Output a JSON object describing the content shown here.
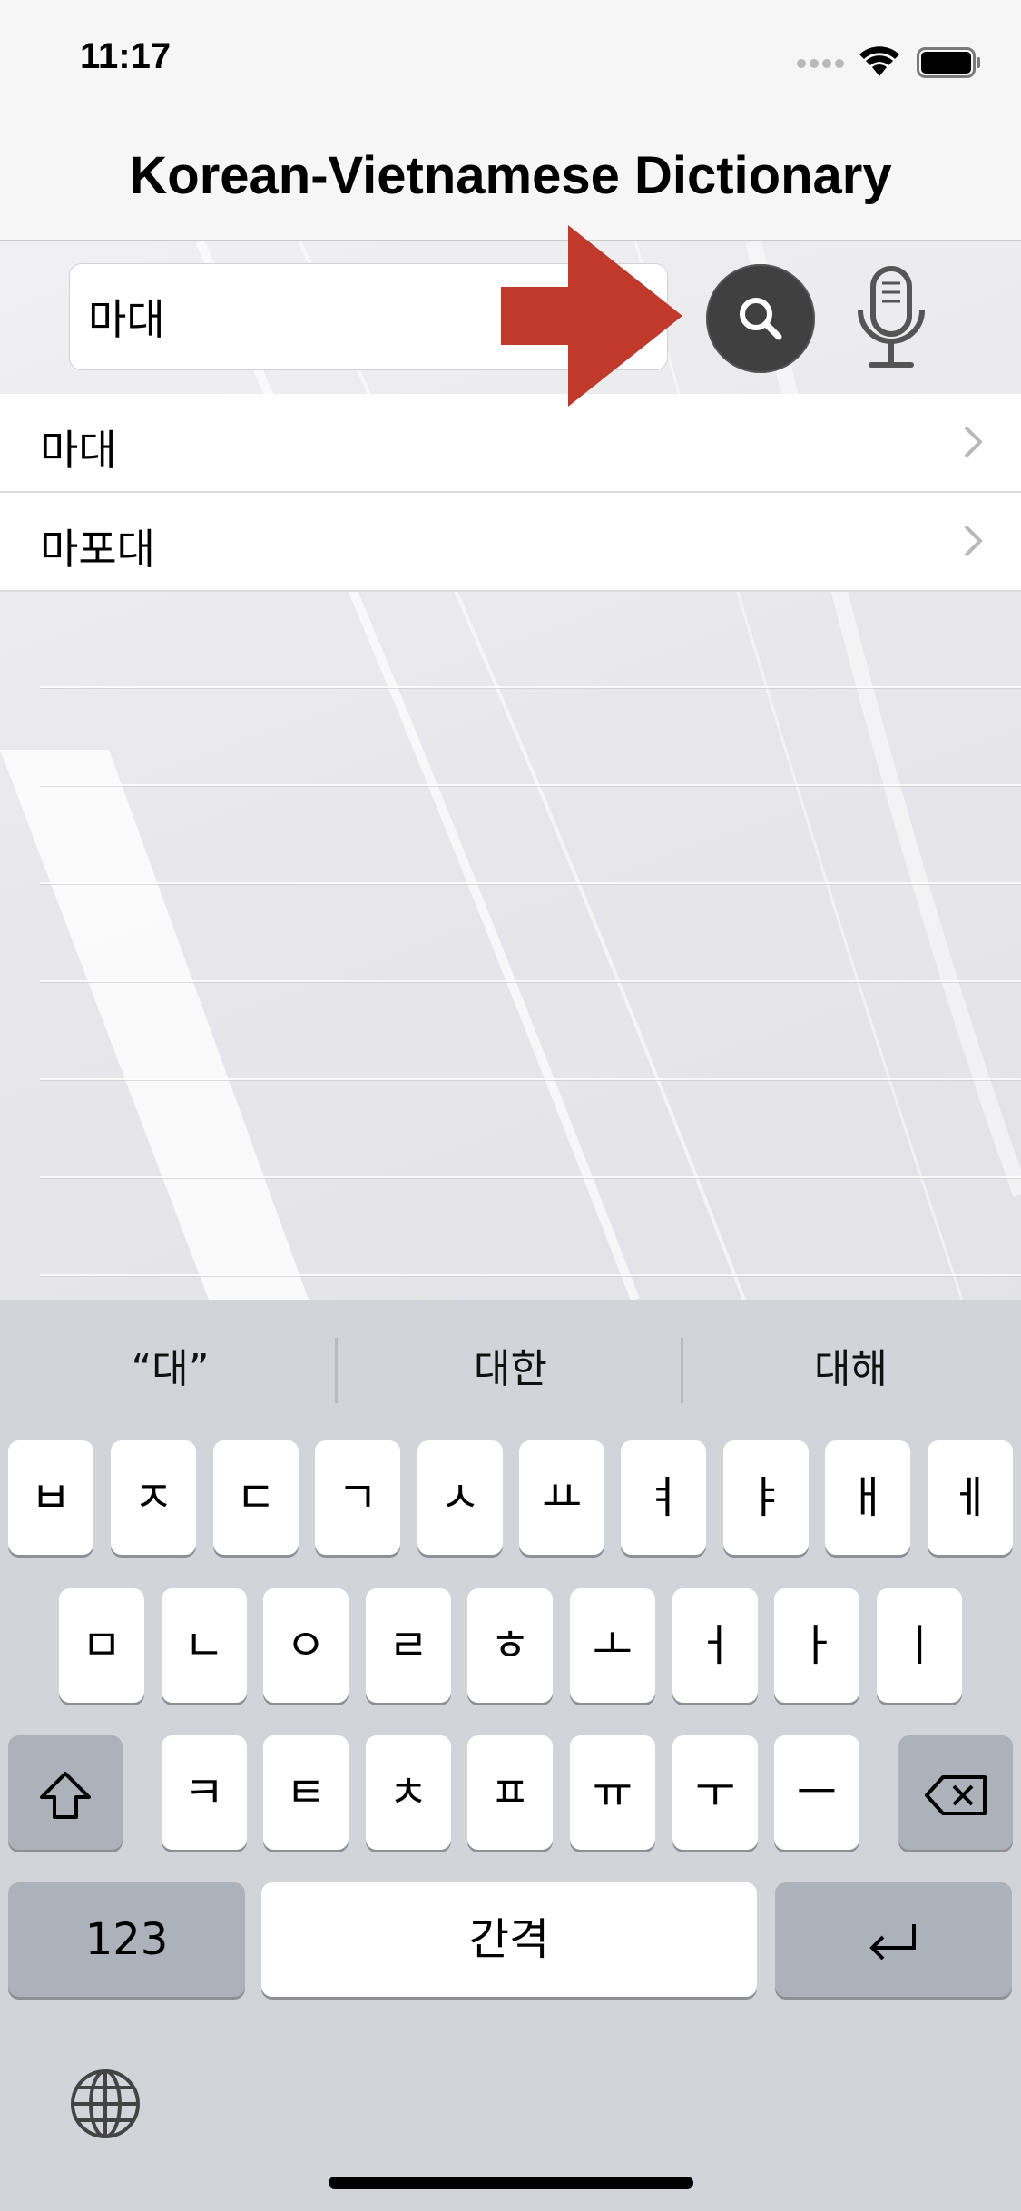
{
  "status_bar": {
    "time": "11:17"
  },
  "nav": {
    "title": "Korean-Vietnamese Dictionary"
  },
  "search": {
    "value": "마대"
  },
  "results": [
    {
      "label": "마대"
    },
    {
      "label": "마포대"
    }
  ],
  "keyboard": {
    "suggestions": [
      "“대”",
      "대한",
      "대해"
    ],
    "row1": [
      "ㅂ",
      "ㅈ",
      "ㄷ",
      "ㄱ",
      "ㅅ",
      "ㅛ",
      "ㅕ",
      "ㅑ",
      "ㅐ",
      "ㅔ"
    ],
    "row2": [
      "ㅁ",
      "ㄴ",
      "ㅇ",
      "ㄹ",
      "ㅎ",
      "ㅗ",
      "ㅓ",
      "ㅏ",
      "ㅣ"
    ],
    "row3": [
      "ㅋ",
      "ㅌ",
      "ㅊ",
      "ㅍ",
      "ㅠ",
      "ㅜ",
      "ㅡ"
    ],
    "numbers_label": "123",
    "space_label": "간격"
  },
  "colors": {
    "arrow": "#c0392b",
    "search_button": "#404040",
    "keyboard_bg": "#d2d4d9"
  },
  "icons": [
    "wifi-icon",
    "battery-icon",
    "search-icon",
    "microphone-icon",
    "chevron-right-icon",
    "shift-icon",
    "delete-icon",
    "return-icon",
    "globe-icon"
  ]
}
